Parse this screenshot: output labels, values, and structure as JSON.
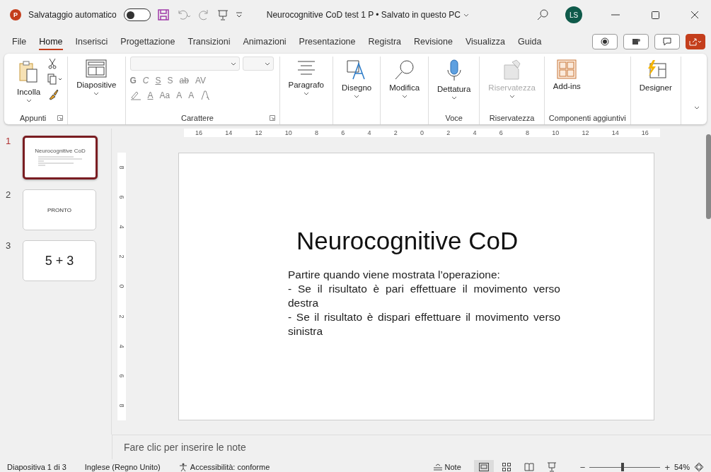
{
  "title_bar": {
    "app_badge": "P",
    "autosave_label": "Salvataggio automatico",
    "autosave_on": false,
    "title": "Neurocognitive CoD test 1 P • Salvato in questo PC",
    "avatar": "LS"
  },
  "tabs": [
    {
      "label": "File",
      "selected": false
    },
    {
      "label": "Home",
      "selected": true
    },
    {
      "label": "Inserisci",
      "selected": false
    },
    {
      "label": "Progettazione",
      "selected": false
    },
    {
      "label": "Transizioni",
      "selected": false
    },
    {
      "label": "Animazioni",
      "selected": false
    },
    {
      "label": "Presentazione",
      "selected": false
    },
    {
      "label": "Registra",
      "selected": false
    },
    {
      "label": "Revisione",
      "selected": false
    },
    {
      "label": "Visualizza",
      "selected": false
    },
    {
      "label": "Guida",
      "selected": false
    }
  ],
  "ribbon": {
    "groups": [
      {
        "kind": "clipboard",
        "label": "Appunti",
        "launcher": true,
        "buttons": [
          {
            "kind": "paste",
            "label": "Incolla",
            "dropdown": true,
            "disabled": false
          }
        ]
      },
      {
        "kind": "plain",
        "buttons": [
          {
            "kind": "layout",
            "label": "Diapositive",
            "dropdown": true,
            "disabled": false
          }
        ]
      },
      {
        "kind": "font",
        "label": "Carattere",
        "launcher": true,
        "row1": [
          "G",
          "C",
          "S",
          "S",
          "ab",
          "AV"
        ],
        "row2": [
          "A",
          "Aa",
          "A",
          "A"
        ]
      },
      {
        "kind": "plain",
        "buttons": [
          {
            "kind": "paragraph",
            "label": "Paragrafo",
            "dropdown": true,
            "disabled": false
          }
        ]
      },
      {
        "kind": "plain",
        "buttons": [
          {
            "kind": "drawing",
            "label": "Disegno",
            "dropdown": true,
            "disabled": false
          }
        ]
      },
      {
        "kind": "plain",
        "buttons": [
          {
            "kind": "search",
            "label": "Modifica",
            "dropdown": true,
            "disabled": false
          }
        ]
      },
      {
        "kind": "plain",
        "label": "Voce",
        "buttons": [
          {
            "kind": "mic",
            "label": "Dettatura",
            "dropdown": true,
            "disabled": false
          }
        ]
      },
      {
        "kind": "plain",
        "label": "Riservatezza",
        "buttons": [
          {
            "kind": "sensitivity",
            "label": "Riservatezza",
            "dropdown": true,
            "disabled": true
          }
        ]
      },
      {
        "kind": "plain",
        "label": "Componenti aggiuntivi",
        "buttons": [
          {
            "kind": "addins",
            "label": "Add-ins",
            "dropdown": false,
            "disabled": false
          }
        ]
      },
      {
        "kind": "plain",
        "buttons": [
          {
            "kind": "designer",
            "label": "Designer",
            "dropdown": false,
            "disabled": false
          }
        ]
      }
    ]
  },
  "slides": [
    {
      "number": "1",
      "selected": true,
      "kind": "text",
      "title": "Neurocognitive CoD"
    },
    {
      "number": "2",
      "selected": false,
      "kind": "word",
      "text": "PRONTO"
    },
    {
      "number": "3",
      "selected": false,
      "kind": "big",
      "text": "5 + 3"
    }
  ],
  "ruler": {
    "horizontal": [
      "16",
      "14",
      "12",
      "10",
      "8",
      "6",
      "4",
      "2",
      "0",
      "2",
      "4",
      "6",
      "8",
      "10",
      "12",
      "14",
      "16"
    ],
    "vertical": [
      "8",
      "6",
      "4",
      "2",
      "0",
      "2",
      "4",
      "6",
      "8"
    ]
  },
  "slide": {
    "title": "Neurocognitive CoD",
    "paragraphs": [
      "Partire quando viene mostrata l’operazione:",
      "- Se il risultato è pari effettuare il movimento verso destra",
      "- Se il risultato è dispari effettuare il movimento verso sinistra"
    ]
  },
  "notes": {
    "placeholder": "Fare clic per inserire le note"
  },
  "status_bar": {
    "slide_info": "Diapositiva 1 di 3",
    "language": "Inglese (Regno Unito)",
    "accessibility": "Accessibilità: conforme",
    "notes": "Note",
    "views": [
      {
        "kind": "normal",
        "selected": true
      },
      {
        "kind": "sorter",
        "selected": false
      },
      {
        "kind": "reading",
        "selected": false
      },
      {
        "kind": "show",
        "selected": false
      }
    ],
    "zoom_minus": "−",
    "zoom_plus": "+",
    "zoom": {
      "level": 0.47
    },
    "zoom_value": "54%"
  }
}
